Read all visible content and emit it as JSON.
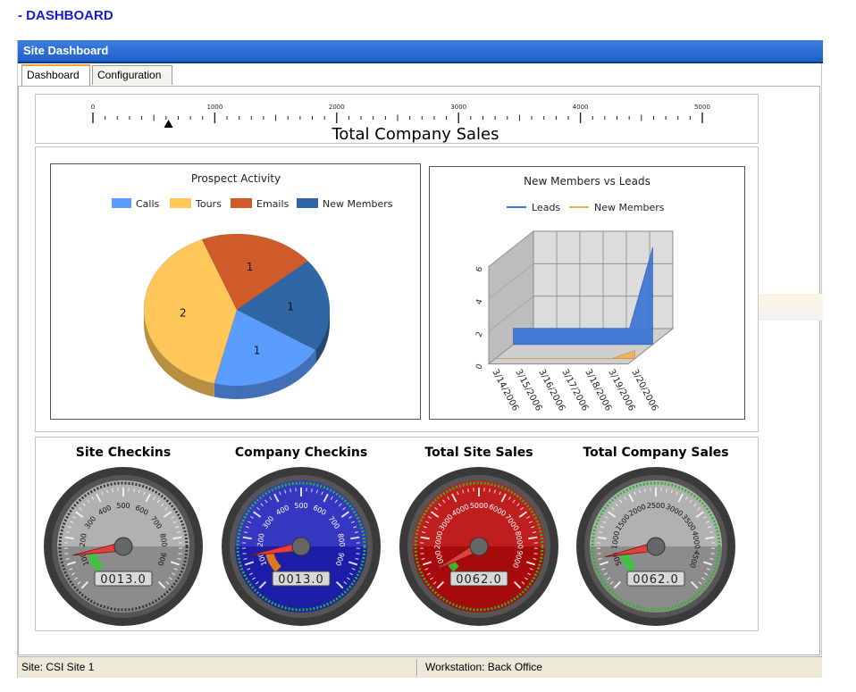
{
  "page": {
    "heading": "- DASHBOARD"
  },
  "window": {
    "title": "Site Dashboard",
    "tabs": [
      {
        "label": "Dashboard",
        "active": true
      },
      {
        "label": "Configuration",
        "active": false
      }
    ]
  },
  "sales_scale": {
    "title": "Total Company Sales",
    "tick_labels": [
      "0",
      "1000",
      "2000",
      "3000",
      "4000",
      "5000"
    ],
    "min": 0,
    "max": 5000,
    "marker_value": 620
  },
  "chart_data": [
    {
      "type": "pie",
      "title": "Prospect Activity",
      "categories": [
        "Calls",
        "Tours",
        "Emails",
        "New Members"
      ],
      "values": [
        1,
        2,
        1,
        1
      ],
      "colors": [
        "#5b9cff",
        "#ffc65a",
        "#cf5b2a",
        "#2e66a6"
      ],
      "legend_placement": "top"
    },
    {
      "type": "area",
      "title": "New Members vs Leads",
      "x": [
        "3/14/2006",
        "3/15/2006",
        "3/16/2006",
        "3/17/2006",
        "3/18/2006",
        "3/19/2006",
        "3/20/2006"
      ],
      "series": [
        {
          "name": "Leads",
          "values": [
            1,
            1,
            1,
            1,
            1,
            1,
            6
          ]
        },
        {
          "name": "New Members",
          "values": [
            0,
            0,
            0,
            0,
            0,
            0,
            0.5
          ]
        }
      ],
      "y_ticks": [
        "0",
        "2",
        "4",
        "6"
      ],
      "ylim": [
        0,
        6
      ],
      "colors": {
        "Leads": "#3a74d6",
        "New Members": "#f0b050"
      },
      "legend_placement": "top",
      "grid": true
    }
  ],
  "gauges": [
    {
      "title": "Site Checkins",
      "labels": [
        "100",
        "200",
        "300",
        "400",
        "500",
        "600",
        "700",
        "800",
        "900"
      ],
      "min": 0,
      "max": 1000,
      "value": 130,
      "odometer": "0013.0",
      "theme": "silver",
      "band_color": "#33cc33"
    },
    {
      "title": "Company Checkins",
      "labels": [
        "100",
        "200",
        "300",
        "400",
        "500",
        "600",
        "700",
        "800",
        "900"
      ],
      "min": 0,
      "max": 1000,
      "value": 130,
      "odometer": "0013.0",
      "theme": "blue",
      "band_color": "#ff8800"
    },
    {
      "title": "Total Site Sales",
      "labels": [
        "1000",
        "2000",
        "3000",
        "4000",
        "5000",
        "6000",
        "7000",
        "8000",
        "9000"
      ],
      "min": 0,
      "max": 10000,
      "value": 620,
      "odometer": "0062.0",
      "theme": "red",
      "band_color": "#33cc33"
    },
    {
      "title": "Total Company Sales",
      "labels": [
        "500",
        "1000",
        "1500",
        "2000",
        "2500",
        "3000",
        "3500",
        "4000",
        "4500"
      ],
      "min": 0,
      "max": 5000,
      "value": 620,
      "odometer": "0062.0",
      "theme": "silver",
      "band_color": "#33cc33"
    }
  ],
  "status": {
    "site": "Site: CSI Site 1",
    "workstation": "Workstation: Back Office"
  }
}
